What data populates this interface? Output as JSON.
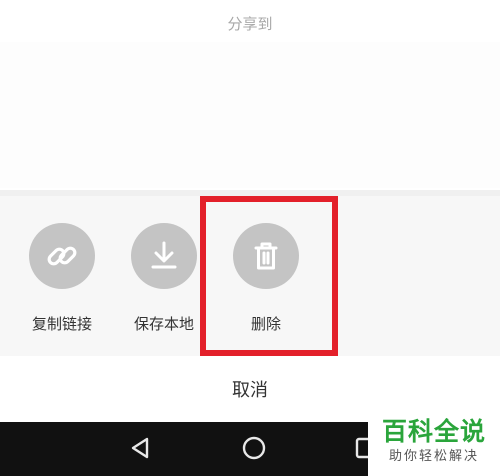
{
  "share_sheet": {
    "title": "分享到"
  },
  "actions": [
    {
      "id": "copy_link",
      "label": "复制链接",
      "icon": "link-icon"
    },
    {
      "id": "save_local",
      "label": "保存本地",
      "icon": "download-icon"
    },
    {
      "id": "delete",
      "label": "删除",
      "icon": "trash-icon"
    }
  ],
  "cancel_label": "取消",
  "navigation_bar": {
    "buttons": [
      "back-triangle-icon",
      "home-circle-icon",
      "recent-square-icon"
    ]
  },
  "watermark": {
    "main": "百科全说",
    "sub": "助你轻松解决"
  },
  "colors": {
    "highlight": "#e3202a",
    "icon_circle": "#c4c4c4",
    "watermark_green": "#2aa53b",
    "navbar": "#111111"
  }
}
